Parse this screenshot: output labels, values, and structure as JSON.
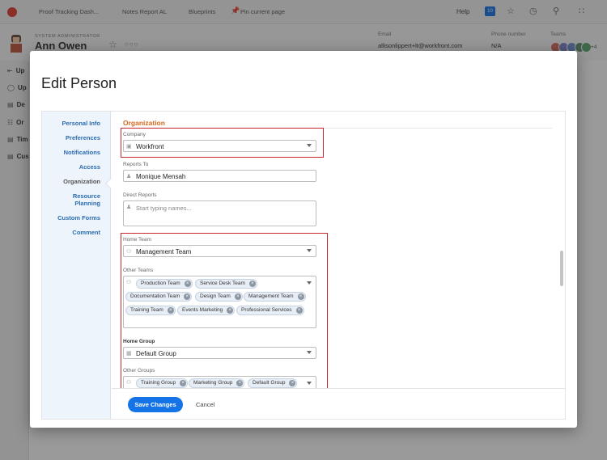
{
  "topbar": {
    "tabs": [
      "Proof Tracking Dash...",
      "Notes Report AL",
      "Blueprints",
      "Pin current page"
    ],
    "help": "Help",
    "badge": "10"
  },
  "profile": {
    "role": "SYSTEM ADMINISTRATOR",
    "name": "Ann Owen",
    "email_label": "Email",
    "email": "allisonlippert+lt@workfront.com",
    "phone_label": "Phone number",
    "phone": "N/A",
    "teams_label": "Teams",
    "teams_more": "+4",
    "team_colors": [
      "#d96b5f",
      "#7c86c9",
      "#6f8fd6",
      "#5b8f6d",
      "#5aa66c"
    ]
  },
  "leftnav": {
    "items": [
      "Up",
      "Up",
      "De",
      "Or",
      "Tim",
      "Cus"
    ]
  },
  "modal": {
    "title": "Edit Person",
    "sidebar": [
      "Personal Info",
      "Preferences",
      "Notifications",
      "Access",
      "Organization",
      "Resource Planning",
      "Custom Forms",
      "Comment"
    ],
    "active_item": "Organization",
    "section_title": "Organization",
    "company": {
      "label": "Company",
      "value": "Workfront"
    },
    "reports_to": {
      "label": "Reports To",
      "value": "Monique Mensah"
    },
    "direct_reports": {
      "label": "Direct Reports",
      "placeholder": "Start typing names..."
    },
    "home_team": {
      "label": "Home Team",
      "value": "Management Team"
    },
    "other_teams": {
      "label": "Other Teams",
      "chips": [
        "Production Team",
        "Service Desk Team",
        "Documentation Team",
        "Design Team",
        "Management Team",
        "Training Team",
        "Events Marketing",
        "Professional Services"
      ]
    },
    "home_group": {
      "label": "Home Group",
      "value": "Default Group"
    },
    "other_groups": {
      "label": "Other Groups",
      "chips": [
        "Training Group",
        "Marketing Group",
        "Default Group"
      ]
    },
    "save_label": "Save Changes",
    "cancel_label": "Cancel"
  },
  "colors": {
    "accent": "#1473e6",
    "section": "#d4681b",
    "highlight": "#c9252c"
  }
}
